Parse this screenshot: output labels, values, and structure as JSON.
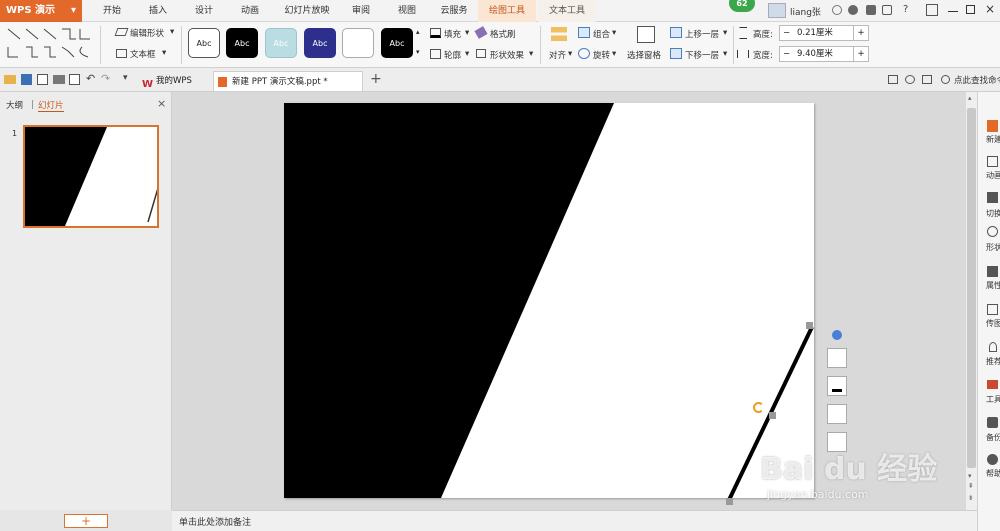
{
  "app": {
    "name": "WPS 演示",
    "menu_arrow": "▾"
  },
  "tabs": [
    {
      "label": "开始"
    },
    {
      "label": "插入"
    },
    {
      "label": "设计"
    },
    {
      "label": "动画"
    },
    {
      "label": "幻灯片放映"
    },
    {
      "label": "审阅"
    },
    {
      "label": "视图"
    },
    {
      "label": "云服务"
    },
    {
      "label": "绘图工具"
    },
    {
      "label": "文本工具"
    }
  ],
  "titlebar": {
    "badge": "62",
    "user": "liang张",
    "help": "?"
  },
  "ribbon": {
    "edit_shape": "编辑形状",
    "text_box": "文本框",
    "styles": [
      {
        "label": "Abc",
        "bg": "#ffffff",
        "fg": "#222222",
        "border": "#555555"
      },
      {
        "label": "Abc",
        "bg": "#000000",
        "fg": "#ffffff",
        "border": "#000000"
      },
      {
        "label": "Abc",
        "bg": "#b9dde3",
        "fg": "#ffffff",
        "border": "#9cc4cc"
      },
      {
        "label": "Abc",
        "bg": "#2c2f8c",
        "fg": "#ffffff",
        "border": "#2c2f8c"
      },
      {
        "label": "",
        "bg": "#ffffff",
        "fg": "#222222",
        "border": "#aaaaaa"
      },
      {
        "label": "Abc",
        "bg": "#000000",
        "fg": "#ffffff",
        "border": "#000000"
      }
    ],
    "fill": "填充",
    "format_painter": "格式刷",
    "outline": "轮廓",
    "shape_effects": "形状效果",
    "align": "对齐",
    "group": "组合",
    "rotate": "旋转",
    "selection_pane": "选择窗格",
    "bring_forward": "上移一层",
    "send_backward": "下移一层",
    "height_label": "高度:",
    "height_value": "0.21厘米",
    "width_label": "宽度:",
    "width_value": "9.40厘米",
    "minus": "−",
    "plus": "+"
  },
  "doc_tabs": {
    "my_wps": "我的WPS",
    "current": "新建 PPT 演示文稿.ppt *",
    "new_tab": "+",
    "search": "点此查找命令"
  },
  "left_pane": {
    "outline_tab": "大纲",
    "slides_tab": "幻灯片",
    "close": "×",
    "slide_number": "1",
    "add_slide": "+"
  },
  "notes": {
    "placeholder": "单击此处添加备注"
  },
  "right_panel": {
    "items": [
      "新建",
      "动画",
      "切换",
      "形状",
      "属性",
      "传图",
      "推荐",
      "工具",
      "备份",
      "帮助"
    ]
  },
  "float_tools": [
    "minus-circle",
    "shape-style",
    "fill-bucket",
    "outline",
    "layers"
  ],
  "watermark": {
    "text": "Bai du 经验",
    "sub": "jingyan.baidu.com"
  },
  "colors": {
    "accent": "#e2692a",
    "drawing_tab": "#fbe6d4",
    "slide_border": "#d9742e"
  }
}
